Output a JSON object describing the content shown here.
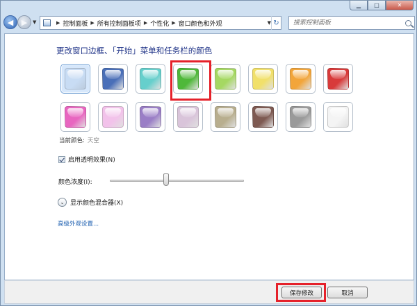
{
  "window": {
    "minimize_glyph": "▁",
    "maximize_glyph": "□",
    "close_glyph": "✕"
  },
  "nav": {
    "back_glyph": "◀",
    "forward_glyph": "▶",
    "history_glyph": "▼"
  },
  "address": {
    "crumbs": [
      "控制面板",
      "所有控制面板项",
      "个性化",
      "窗口颜色和外观"
    ],
    "separator_glyph": "▶",
    "drop_glyph": "▼",
    "refresh_glyph": "↻"
  },
  "search": {
    "placeholder": "搜索控制面板"
  },
  "content": {
    "heading": "更改窗口边框、「开始」菜单和任务栏的颜色",
    "current_color_label": "当前颜色:",
    "current_color_value": "天空",
    "selected_swatch_index": 0,
    "highlighted_swatch_index": 3,
    "swatch_colors": [
      "#c8dcf4",
      "#4a6fb8",
      "#66cfcc",
      "#4fb83a",
      "#a5d862",
      "#f1e06a",
      "#f2a53a",
      "#d83a3a",
      "#e866c0",
      "#f2c2ea",
      "#9a7ec6",
      "#d9c4da",
      "#b8ae8e",
      "#7e5a52",
      "#9a9a9a",
      "#f4f4f4"
    ],
    "transparency_label": "启用透明效果(N)",
    "transparency_checked": true,
    "intensity_label": "颜色浓度(I):",
    "intensity_value_fraction": 0.42,
    "mixer_label": "显示颜色混合器(X)",
    "mixer_glyph": "⌄",
    "advanced_link": "高级外观设置..."
  },
  "footer": {
    "save_label": "保存修改",
    "cancel_label": "取消"
  },
  "colors": {
    "highlight_red": "#e5212a",
    "heading_blue": "#1e3287",
    "link_blue": "#1d5fb0"
  }
}
